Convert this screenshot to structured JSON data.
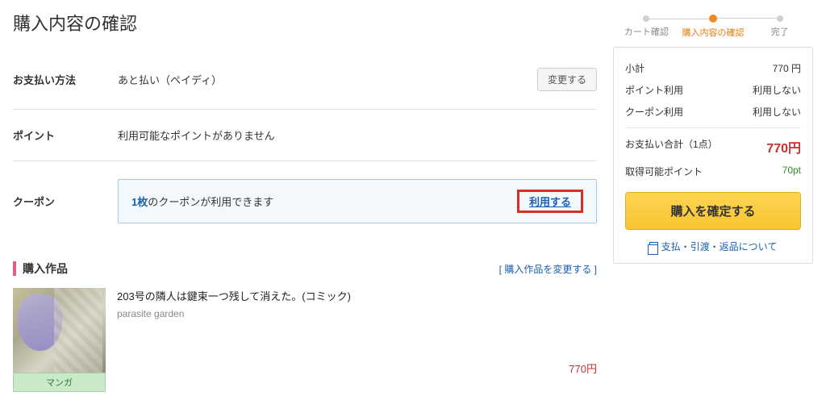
{
  "page_title": "購入内容の確認",
  "payment": {
    "label": "お支払い方法",
    "value": "あと払い（ペイディ）",
    "change_btn": "変更する"
  },
  "points": {
    "label": "ポイント",
    "value": "利用可能なポイントがありません"
  },
  "coupon": {
    "label": "クーポン",
    "count": "1枚",
    "text": "のクーポンが利用できます",
    "use_link": "利用する"
  },
  "products_section": {
    "title": "購入作品",
    "change_link": "[ 購入作品を変更する ]"
  },
  "product": {
    "title": "203号の隣人は鍵束一つ残して消えた。(コミック)",
    "author": "parasite garden",
    "price": "770円",
    "category": "マンガ"
  },
  "steps": {
    "s1": "カート確認",
    "s2": "購入内容の確認",
    "s3": "完了"
  },
  "summary": {
    "subtotal_label": "小計",
    "subtotal_val": "770 円",
    "pt_use_label": "ポイント利用",
    "pt_use_val": "利用しない",
    "cp_use_label": "クーポン利用",
    "cp_use_val": "利用しない",
    "total_label": "お支払い合計（1点）",
    "total_val": "770円",
    "earn_label": "取得可能ポイント",
    "earn_val": "70pt",
    "confirm_btn": "購入を確定する",
    "policy": "支払・引渡・返品について"
  }
}
